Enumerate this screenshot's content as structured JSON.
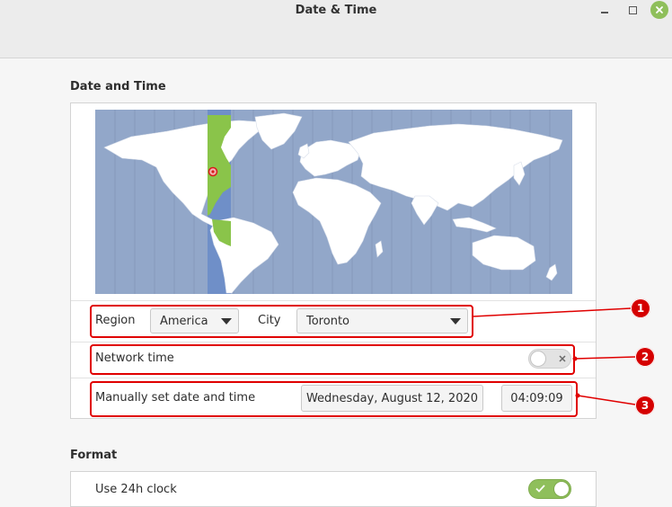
{
  "window": {
    "title": "Date & Time"
  },
  "sections": {
    "date_time_title": "Date and Time",
    "format_title": "Format"
  },
  "location": {
    "region_label": "Region",
    "region_value": "America",
    "city_label": "City",
    "city_value": "Toronto"
  },
  "network_time": {
    "label": "Network time",
    "enabled": false
  },
  "manual": {
    "label": "Manually set date and time",
    "date_value": "Wednesday, August 12, 2020",
    "time_value": "04:09:09"
  },
  "format": {
    "clock_24h_label": "Use 24h clock",
    "clock_24h_enabled": true
  },
  "annotations": [
    "1",
    "2",
    "3"
  ],
  "colors": {
    "accent_green": "#8fbf5b",
    "map_ocean": "#92a7c9",
    "timezone_band": "#6f8fc8",
    "timezone_land": "#8ac44a",
    "annotation_red": "#e00000"
  },
  "icons": {
    "close": "close-icon",
    "minimize": "minimize-icon",
    "maximize": "maximize-icon",
    "dropdown": "chevron-down-icon",
    "check": "check-icon",
    "cross": "x-icon",
    "location_pin": "location-pin-icon"
  }
}
